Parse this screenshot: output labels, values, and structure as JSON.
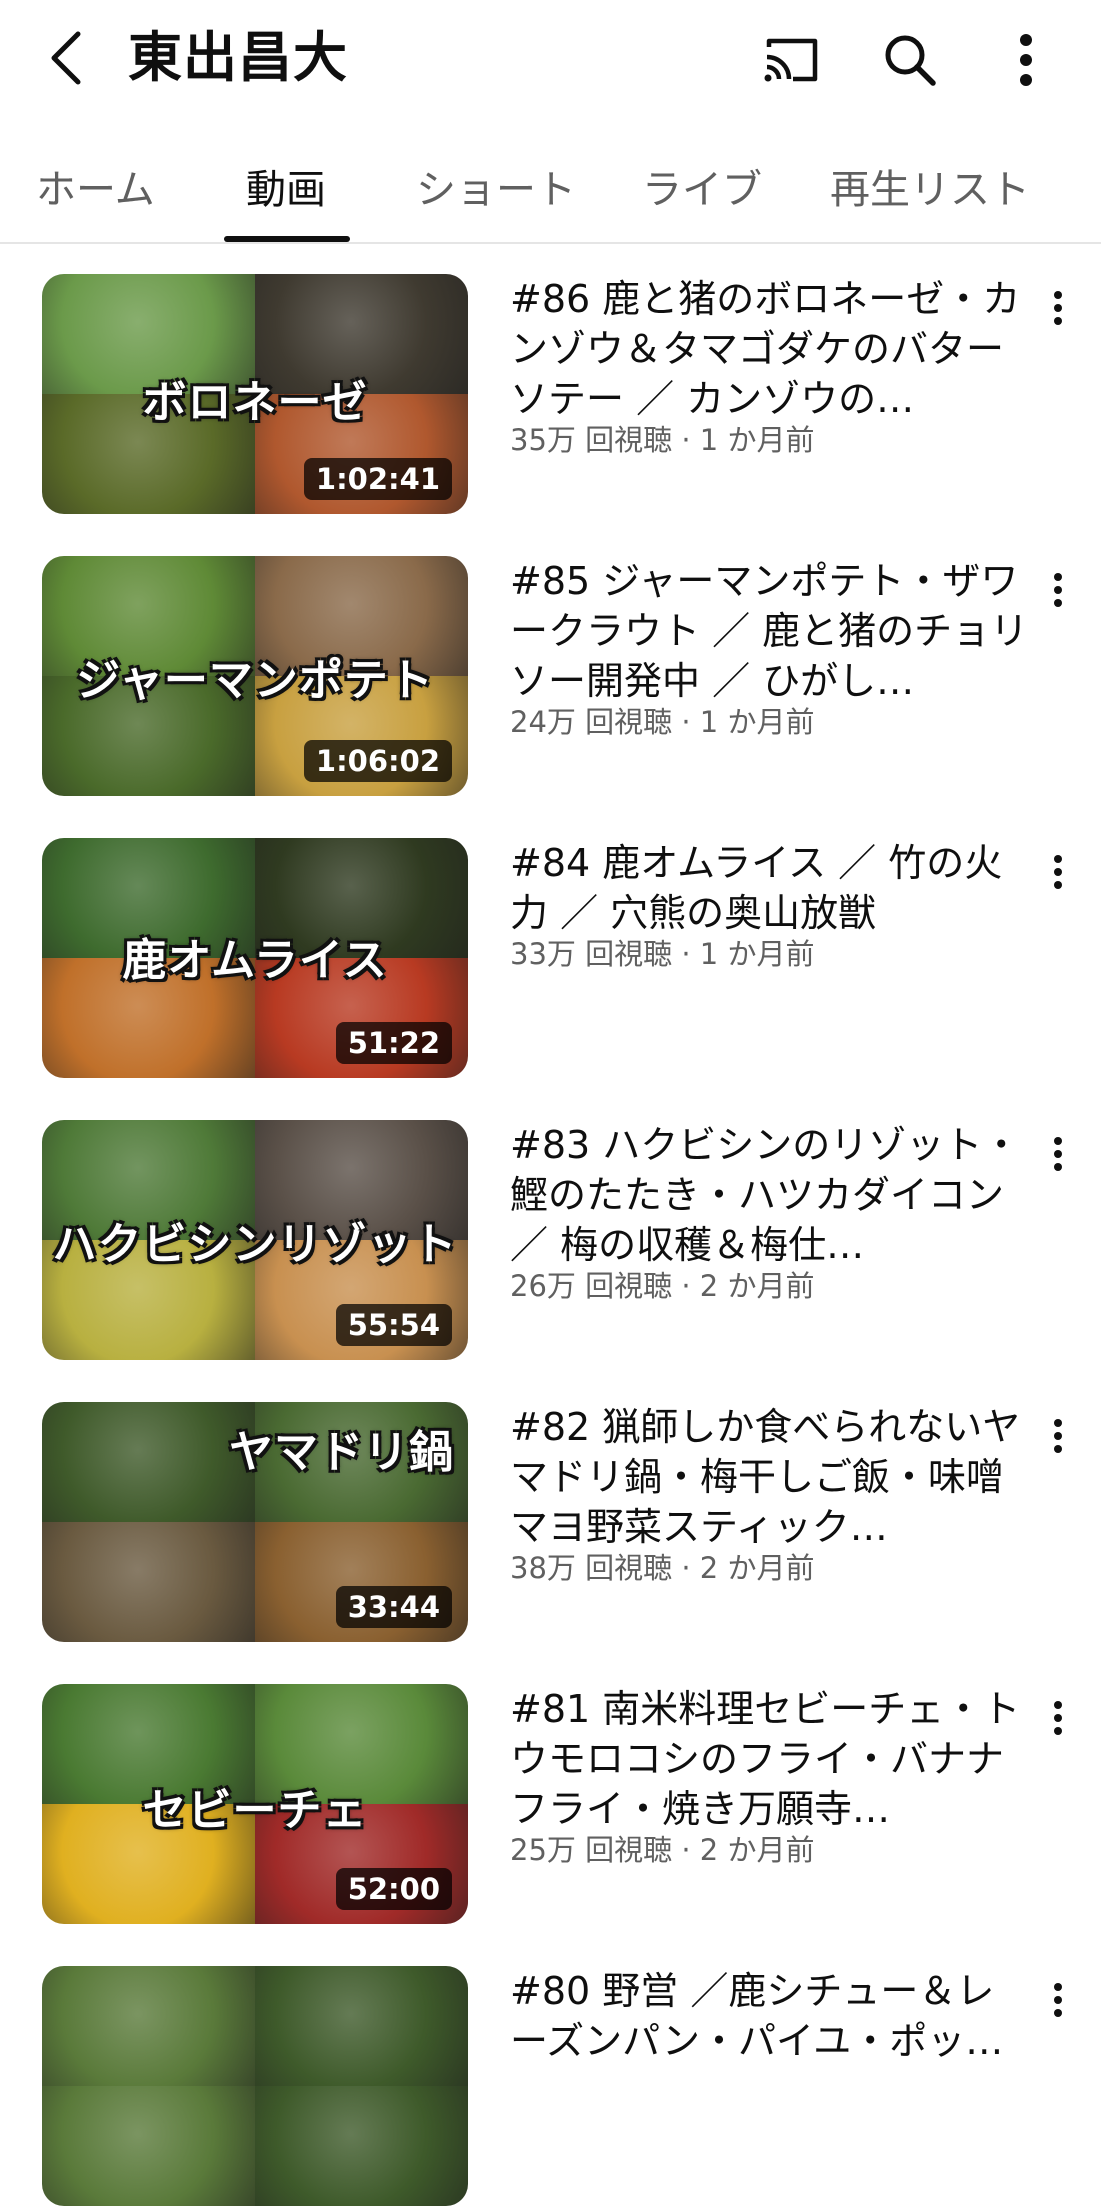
{
  "header": {
    "title": "東出昌大",
    "back_icon": "chevron-left-icon",
    "cast_icon": "cast-icon",
    "search_icon": "search-icon",
    "more_icon": "more-vertical-icon"
  },
  "tabs": [
    {
      "label": "ホーム",
      "active": false
    },
    {
      "label": "動画",
      "active": true
    },
    {
      "label": "ショート",
      "active": false
    },
    {
      "label": "ライブ",
      "active": false
    },
    {
      "label": "再生リスト",
      "active": false
    }
  ],
  "videos": [
    {
      "title": "#86 鹿と猪のボロネーゼ・カンゾウ＆タマゴダケのバターソテー ／ カンゾウの…",
      "stats": "35万 回視聴 · 1 か月前",
      "duration": "1:02:41",
      "caption": "ボロネーゼ",
      "colors": [
        "#6b9a4a",
        "#3f3a30",
        "#5a6a28",
        "#b0582e"
      ]
    },
    {
      "title": "#85 ジャーマンポテト・ザワークラウト ／ 鹿と猪のチョリソー開発中 ／ ひがし…",
      "stats": "24万 回視聴 · 1 か月前",
      "duration": "1:06:02",
      "caption": "ジャーマンポテト",
      "colors": [
        "#5f8a36",
        "#8a6a4a",
        "#4a6a2a",
        "#c8a040"
      ]
    },
    {
      "title": "#84 鹿オムライス ／ 竹の火力 ／ 穴熊の奥山放獣",
      "stats": "33万 回視聴 · 1 か月前",
      "duration": "51:22",
      "caption": "鹿オムライス",
      "colors": [
        "#3e6b2e",
        "#2f3a20",
        "#c0702a",
        "#b83a22"
      ]
    },
    {
      "title": "#83 ハクビシンのリゾット・鰹のたたき・ハツカダイコン ／ 梅の収穫＆梅仕…",
      "stats": "26万 回視聴 · 2 か月前",
      "duration": "55:54",
      "caption": "ハクビシンリゾット",
      "colors": [
        "#4f7a38",
        "#5a5048",
        "#b8b040",
        "#c89050"
      ]
    },
    {
      "title": "#82 猟師しか食べられないヤマドリ鍋・梅干しご飯・味噌マヨ野菜スティック…",
      "stats": "38万 回視聴 · 2 か月前",
      "duration": "33:44",
      "caption": "ヤマドリ鍋",
      "colors": [
        "#3f5a2a",
        "#4a6a32",
        "#6a5a40",
        "#8a6030"
      ]
    },
    {
      "title": "#81 南米料理セビーチェ・トウモロコシのフライ・バナナフライ・焼き万願寺…",
      "stats": "25万 回視聴 · 2 か月前",
      "duration": "52:00",
      "caption": "セビーチェ",
      "colors": [
        "#4a7a32",
        "#5a8a3a",
        "#e0b020",
        "#a02a28"
      ]
    },
    {
      "title": "#80 野営 ／鹿シチュー＆レーズンパン・パイユ・ポッ…",
      "stats": "",
      "duration": "",
      "caption": "",
      "colors": [
        "#5a7a3a",
        "#3e5a2a",
        "#5a7a3a",
        "#3e5a2a"
      ]
    }
  ]
}
